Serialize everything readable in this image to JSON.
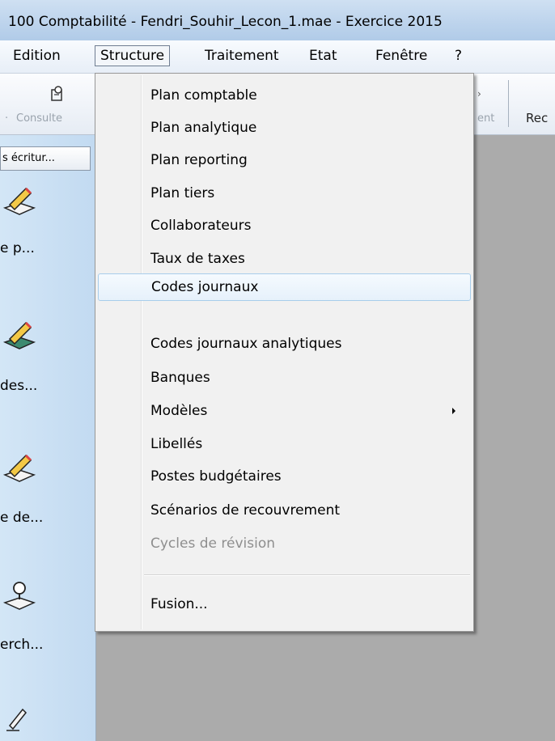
{
  "window": {
    "title": "100 Comptabilité - Fendri_Souhir_Lecon_1.mae - Exercice 2015"
  },
  "menubar": {
    "items": [
      {
        "label": "Edition"
      },
      {
        "label": "Structure",
        "active": true
      },
      {
        "label": "Traitement"
      },
      {
        "label": "Etat"
      },
      {
        "label": "Fenêtre"
      },
      {
        "label": "?"
      }
    ]
  },
  "toolbar": {
    "consult_label": "Consulte",
    "partial_label": "ent",
    "right_label": "Rec"
  },
  "leftpanel": {
    "tab_label": "s écritur...",
    "items": [
      {
        "label": "e p...",
        "icon": "pencil-doc-icon"
      },
      {
        "label": " des...",
        "icon": "pencil-stamp-icon"
      },
      {
        "label": "e de...",
        "icon": "pencil-doc-icon"
      },
      {
        "label": "erch...",
        "icon": "search-doc-icon"
      }
    ]
  },
  "structure_menu": {
    "items": [
      {
        "label": "Plan comptable"
      },
      {
        "label": "Plan analytique"
      },
      {
        "label": "Plan reporting"
      },
      {
        "label": "Plan tiers"
      },
      {
        "label": "Collaborateurs"
      },
      {
        "label": "Taux de taxes"
      },
      {
        "label": "Codes journaux",
        "highlighted": true
      },
      {
        "label": "Codes journaux analytiques"
      },
      {
        "label": "Banques"
      },
      {
        "label": "Modèles",
        "submenu": true
      },
      {
        "label": "Libellés"
      },
      {
        "label": "Postes budgétaires"
      },
      {
        "label": "Scénarios de recouvrement"
      },
      {
        "label": "Cycles de révision",
        "disabled": true
      },
      {
        "label": "Fusion..."
      }
    ]
  },
  "colors": {
    "workspace": "#ababab",
    "titlebar": "#bcd3ec",
    "highlight_border": "#a8cdeb"
  }
}
